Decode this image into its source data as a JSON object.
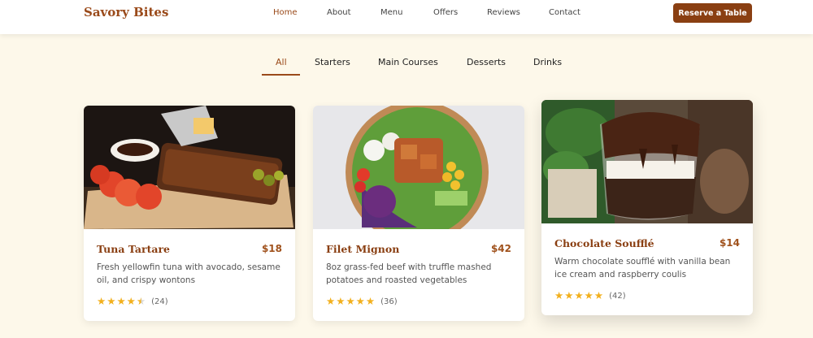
{
  "brand": {
    "name": "Savory Bites"
  },
  "nav": {
    "links": [
      "Home",
      "About",
      "Menu",
      "Offers",
      "Reviews",
      "Contact"
    ],
    "active": "Home",
    "cta": "Reserve a Table"
  },
  "filters": {
    "tabs": [
      "All",
      "Starters",
      "Main Courses",
      "Desserts",
      "Drinks"
    ],
    "active": "All"
  },
  "cards": [
    {
      "title": "Tuna Tartare",
      "price": "$18",
      "desc": "Fresh yellowfin tuna with avocado, sesame oil, and crispy wontons",
      "rating": 4.5,
      "reviews": "(24)",
      "image": "ribs-platter"
    },
    {
      "title": "Filet Mignon",
      "price": "$42",
      "desc": "8oz grass-fed beef with truffle mashed potatoes and roasted vegetables",
      "rating": 5,
      "reviews": "(36)",
      "image": "salad-bowl"
    },
    {
      "title": "Chocolate Soufflé",
      "price": "$14",
      "desc": "Warm chocolate soufflé with vanilla bean ice cream and raspberry coulis",
      "rating": 5,
      "reviews": "(42)",
      "image": "chocolate-parfait"
    }
  ],
  "colors": {
    "accent": "#9a4a1a",
    "background": "#fdf8ea",
    "star": "#f2b01e"
  }
}
